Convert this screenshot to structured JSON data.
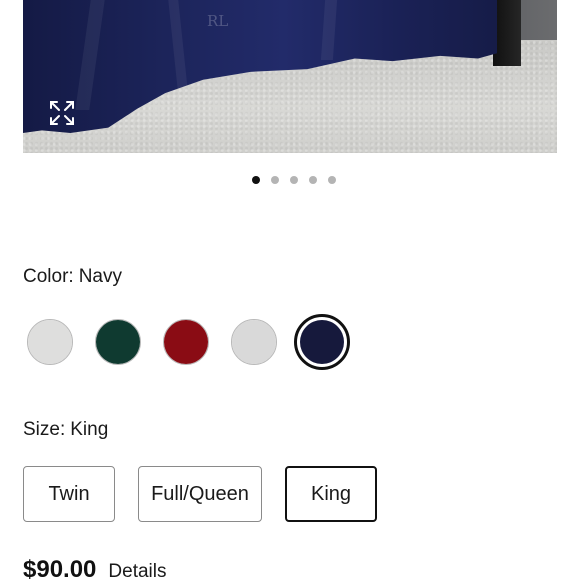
{
  "product_image": {
    "expand_icon": "expand-arrows-icon",
    "carousel": {
      "total": 5,
      "active_index": 0
    }
  },
  "color": {
    "label": "Color:",
    "value": "Navy",
    "swatches": [
      {
        "name": "light-gray",
        "hex": "#dededd",
        "selected": false
      },
      {
        "name": "green",
        "hex": "#0f3a30",
        "selected": false
      },
      {
        "name": "red",
        "hex": "#8a0c14",
        "selected": false
      },
      {
        "name": "light-gray-2",
        "hex": "#d9d9d9",
        "selected": false
      },
      {
        "name": "navy",
        "hex": "#16193c",
        "selected": true
      }
    ]
  },
  "size": {
    "label": "Size:",
    "value": "King",
    "options": [
      {
        "label": "Twin",
        "selected": false
      },
      {
        "label": "Full/Queen",
        "selected": false
      },
      {
        "label": "King",
        "selected": true
      }
    ]
  },
  "price": {
    "amount": "$90.00",
    "details_label": "Details"
  }
}
